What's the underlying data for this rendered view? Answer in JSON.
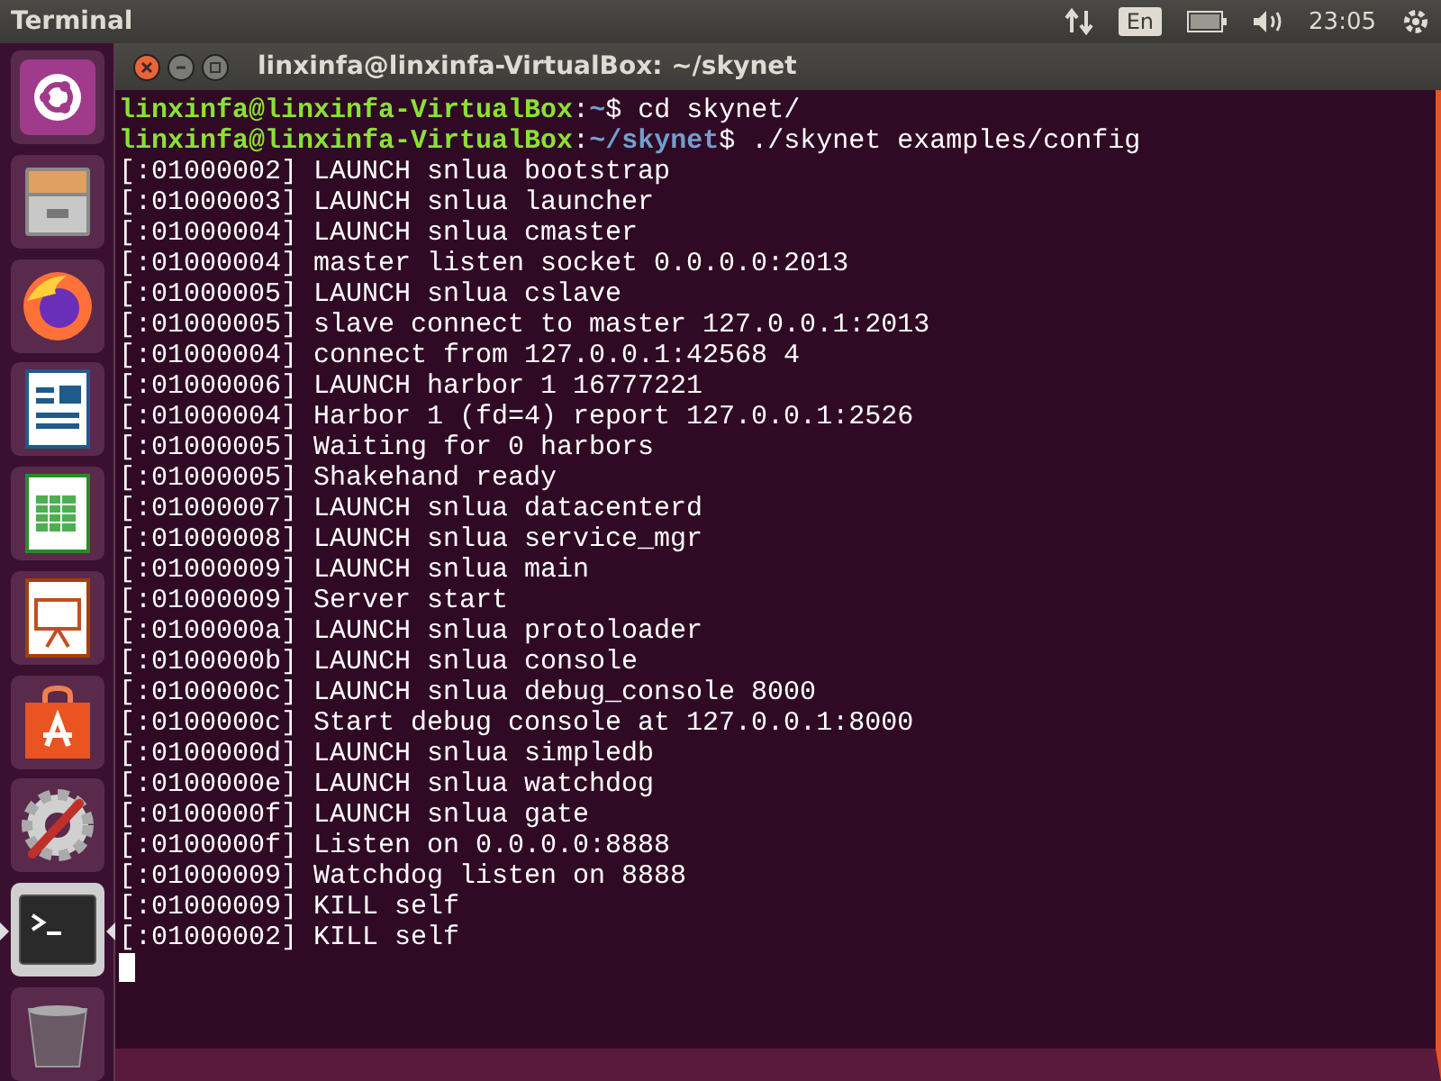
{
  "top_panel": {
    "app_title": "Terminal",
    "keyboard_layout": "En",
    "clock": "23:05"
  },
  "launcher": [
    {
      "kind": "ubuntu",
      "running": false
    },
    {
      "kind": "files",
      "running": false
    },
    {
      "kind": "browser",
      "running": false
    },
    {
      "kind": "writer",
      "running": false
    },
    {
      "kind": "calc",
      "running": false
    },
    {
      "kind": "impress",
      "running": false
    },
    {
      "kind": "store",
      "running": false
    },
    {
      "kind": "settings",
      "running": false
    },
    {
      "kind": "terminal",
      "running": true
    },
    {
      "kind": "trash",
      "running": false
    }
  ],
  "window": {
    "title": "linxinfa@linxinfa-VirtualBox: ~/skynet"
  },
  "terminal": {
    "lines": [
      {
        "kind": "prompt",
        "user_host": "linxinfa@linxinfa-VirtualBox",
        "separator": ":",
        "path": "~",
        "command": "$ cd skynet/"
      },
      {
        "kind": "prompt",
        "user_host": "linxinfa@linxinfa-VirtualBox",
        "separator": ":",
        "path": "~/skynet",
        "command": "$ ./skynet examples/config"
      },
      {
        "kind": "output",
        "text": "[:01000002] LAUNCH snlua bootstrap"
      },
      {
        "kind": "output",
        "text": "[:01000003] LAUNCH snlua launcher"
      },
      {
        "kind": "output",
        "text": "[:01000004] LAUNCH snlua cmaster"
      },
      {
        "kind": "output",
        "text": "[:01000004] master listen socket 0.0.0.0:2013"
      },
      {
        "kind": "output",
        "text": "[:01000005] LAUNCH snlua cslave"
      },
      {
        "kind": "output",
        "text": "[:01000005] slave connect to master 127.0.0.1:2013"
      },
      {
        "kind": "output",
        "text": "[:01000004] connect from 127.0.0.1:42568 4"
      },
      {
        "kind": "output",
        "text": "[:01000006] LAUNCH harbor 1 16777221"
      },
      {
        "kind": "output",
        "text": "[:01000004] Harbor 1 (fd=4) report 127.0.0.1:2526"
      },
      {
        "kind": "output",
        "text": "[:01000005] Waiting for 0 harbors"
      },
      {
        "kind": "output",
        "text": "[:01000005] Shakehand ready"
      },
      {
        "kind": "output",
        "text": "[:01000007] LAUNCH snlua datacenterd"
      },
      {
        "kind": "output",
        "text": "[:01000008] LAUNCH snlua service_mgr"
      },
      {
        "kind": "output",
        "text": "[:01000009] LAUNCH snlua main"
      },
      {
        "kind": "output",
        "text": "[:01000009] Server start"
      },
      {
        "kind": "output",
        "text": "[:0100000a] LAUNCH snlua protoloader"
      },
      {
        "kind": "output",
        "text": "[:0100000b] LAUNCH snlua console"
      },
      {
        "kind": "output",
        "text": "[:0100000c] LAUNCH snlua debug_console 8000"
      },
      {
        "kind": "output",
        "text": "[:0100000c] Start debug console at 127.0.0.1:8000"
      },
      {
        "kind": "output",
        "text": "[:0100000d] LAUNCH snlua simpledb"
      },
      {
        "kind": "output",
        "text": "[:0100000e] LAUNCH snlua watchdog"
      },
      {
        "kind": "output",
        "text": "[:0100000f] LAUNCH snlua gate"
      },
      {
        "kind": "output",
        "text": "[:0100000f] Listen on 0.0.0.0:8888"
      },
      {
        "kind": "output",
        "text": "[:01000009] Watchdog listen on 8888"
      },
      {
        "kind": "output",
        "text": "[:01000009] KILL self"
      },
      {
        "kind": "output",
        "text": "[:01000002] KILL self"
      },
      {
        "kind": "cursor"
      }
    ]
  }
}
